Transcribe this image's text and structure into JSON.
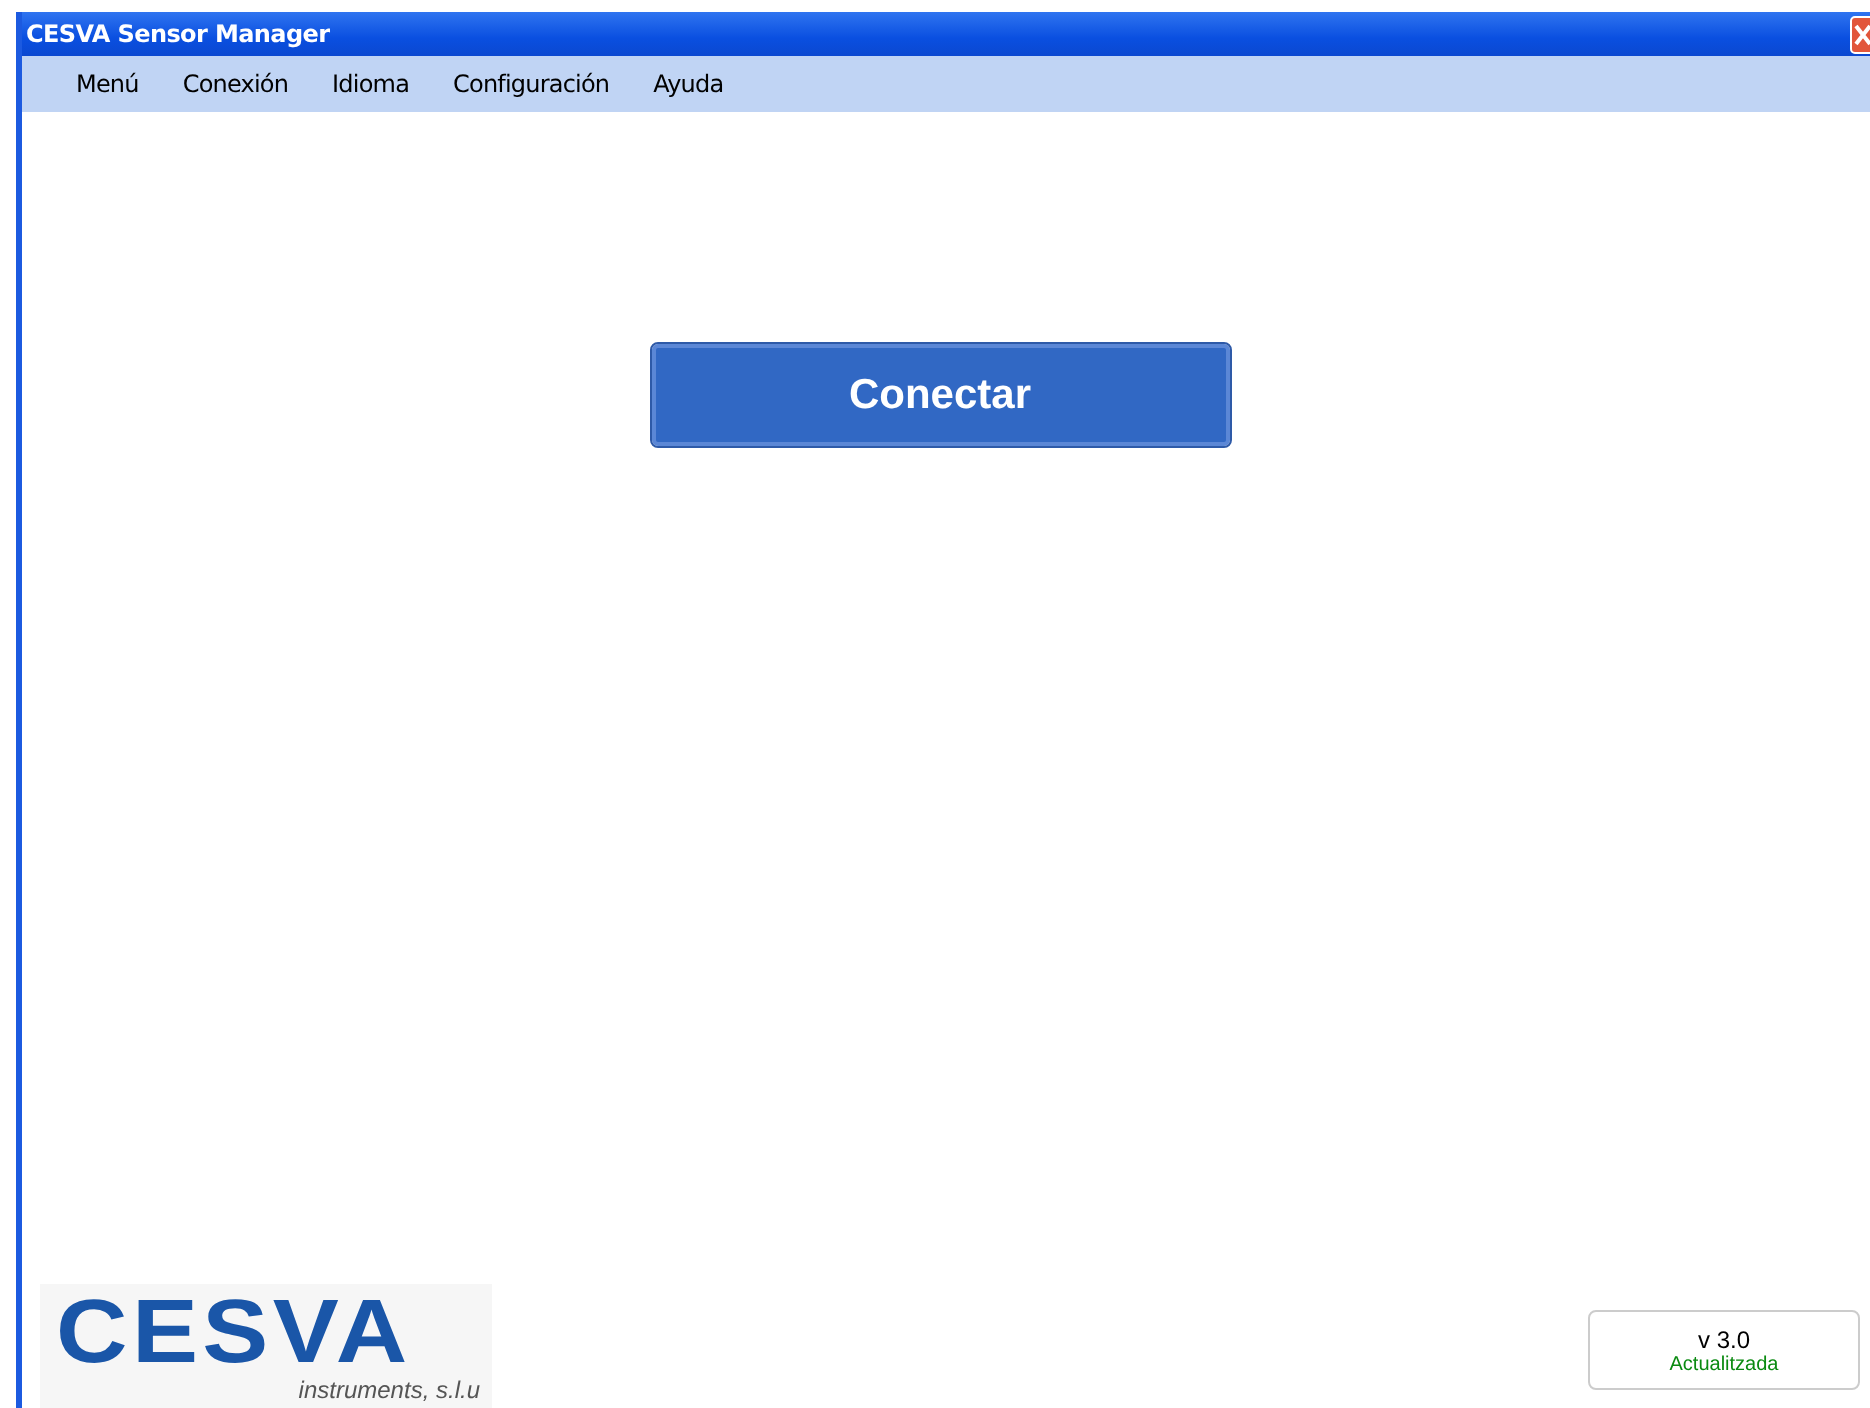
{
  "window": {
    "title": "CESVA Sensor Manager"
  },
  "menu": [
    "Menú",
    "Conexión",
    "Idioma",
    "Configuración",
    "Ayuda"
  ],
  "connect_button": {
    "label": "Conectar"
  },
  "logo": {
    "name": "CESVA",
    "tagline": "instruments, s.l.u"
  },
  "version": {
    "number": "v 3.0",
    "status": "Actualitzada"
  }
}
